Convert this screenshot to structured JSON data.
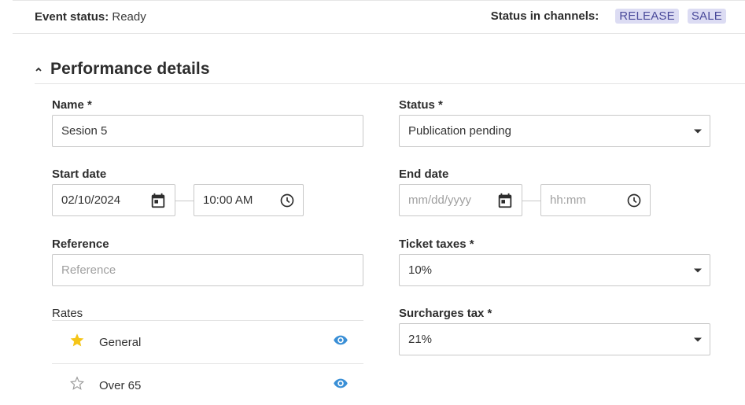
{
  "header": {
    "event_status_label": "Event status:",
    "event_status_value": "Ready",
    "channels_label": "Status in channels:",
    "channels": [
      "RELEASE",
      "SALE"
    ]
  },
  "section": {
    "title": "Performance details",
    "toggle_icon": "chevron-up-icon"
  },
  "form": {
    "name": {
      "label": "Name *",
      "value": "Sesion 5"
    },
    "status": {
      "label": "Status *",
      "value": "Publication pending",
      "icon": "dropdown-caret-icon"
    },
    "start_date": {
      "label": "Start date",
      "date": "02/10/2024",
      "time": "10:00 AM",
      "date_icon": "calendar-icon",
      "time_icon": "clock-icon"
    },
    "end_date": {
      "label": "End date",
      "date_placeholder": "mm/dd/yyyy",
      "time_placeholder": "hh:mm",
      "date_icon": "calendar-icon",
      "time_icon": "clock-icon"
    },
    "reference": {
      "label": "Reference",
      "placeholder": "Reference"
    },
    "ticket_taxes": {
      "label": "Ticket taxes *",
      "value": "10%"
    },
    "surcharges_tax": {
      "label": "Surcharges tax *",
      "value": "21%"
    }
  },
  "rates": {
    "label": "Rates",
    "items": [
      {
        "name": "General",
        "default": true,
        "star_icon": "star-filled-icon",
        "eye_icon": "eye-icon"
      },
      {
        "name": "Over 65",
        "default": false,
        "star_icon": "star-outline-icon",
        "eye_icon": "eye-icon"
      }
    ]
  },
  "colors": {
    "chip_bg": "#dcdcf3",
    "chip_text": "#4a4a9a",
    "star_gold": "#f5c518",
    "eye_blue": "#3a8fd6",
    "border": "#c8c8c8"
  }
}
